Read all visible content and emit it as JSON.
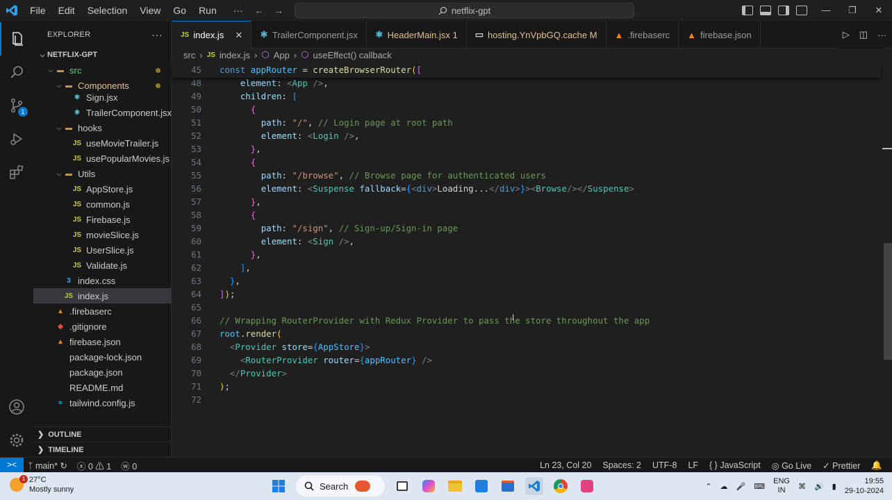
{
  "titlebar": {
    "menu": [
      "File",
      "Edit",
      "Selection",
      "View",
      "Go",
      "Run"
    ],
    "more": "···",
    "search": "netflix-gpt"
  },
  "activity": {
    "scm_badge": "1"
  },
  "sidebar": {
    "header": "EXPLORER",
    "more": "···",
    "rows": [
      {
        "label": "NETFLIX-GPT",
        "kind": "root",
        "indent": 0
      },
      {
        "label": "src",
        "kind": "folder",
        "indent": 1
      },
      {
        "label": "Components",
        "kind": "folder",
        "indent": 2
      },
      {
        "label": "Sign.jsx",
        "kind": "react",
        "indent": 3
      },
      {
        "label": "TrailerComponent.jsx",
        "kind": "react",
        "indent": 3
      },
      {
        "label": "hooks",
        "kind": "folder",
        "indent": 2
      },
      {
        "label": "useMovieTrailer.js",
        "kind": "js",
        "indent": 3
      },
      {
        "label": "usePopularMovies.js",
        "kind": "js",
        "indent": 3
      },
      {
        "label": "Utils",
        "kind": "folder",
        "indent": 2
      },
      {
        "label": "AppStore.js",
        "kind": "js",
        "indent": 3
      },
      {
        "label": "common.js",
        "kind": "js",
        "indent": 3
      },
      {
        "label": "Firebase.js",
        "kind": "js",
        "indent": 3
      },
      {
        "label": "movieSlice.js",
        "kind": "js",
        "indent": 3
      },
      {
        "label": "UserSlice.js",
        "kind": "js",
        "indent": 3
      },
      {
        "label": "Validate.js",
        "kind": "js",
        "indent": 3
      },
      {
        "label": "index.css",
        "kind": "css",
        "indent": 2
      },
      {
        "label": "index.js",
        "kind": "js",
        "indent": 2
      },
      {
        "label": ".firebaserc",
        "kind": "firebase",
        "indent": 1
      },
      {
        "label": ".gitignore",
        "kind": "git",
        "indent": 1
      },
      {
        "label": "firebase.json",
        "kind": "firebase",
        "indent": 1
      },
      {
        "label": "package-lock.json",
        "kind": "plain",
        "indent": 1
      },
      {
        "label": "package.json",
        "kind": "plain",
        "indent": 1
      },
      {
        "label": "README.md",
        "kind": "plain",
        "indent": 1
      },
      {
        "label": "tailwind.config.js",
        "kind": "tw",
        "indent": 1
      }
    ],
    "outline": "OUTLINE",
    "timeline": "TIMELINE"
  },
  "tabs": [
    {
      "label": "index.js",
      "icon": "JS"
    },
    {
      "label": "TrailerComponent.jsx",
      "icon": "react"
    },
    {
      "label": "HeaderMain.jsx 1",
      "icon": "react"
    },
    {
      "label": "hosting.YnVpbGQ.cache M",
      "icon": "file"
    },
    {
      "label": ".firebaserc",
      "icon": "firebase"
    },
    {
      "label": "firebase.json",
      "icon": "firebase"
    }
  ],
  "breadcrumb": [
    "src",
    "index.js",
    "App",
    "useEffect() callback"
  ],
  "code": [
    {
      "n": "45",
      "t": [
        [
          "kw",
          "const "
        ],
        [
          "var",
          "appRouter"
        ],
        [
          "punc",
          " = "
        ],
        [
          "fn",
          "createBrowserRouter"
        ],
        [
          "p1",
          "("
        ],
        [
          "p2",
          "["
        ]
      ]
    },
    {
      "n": "48",
      "t": [
        [
          "punc",
          "    "
        ],
        [
          "prop",
          "element"
        ],
        [
          "punc",
          ": "
        ],
        [
          "br",
          "<"
        ],
        [
          "tag",
          "App"
        ],
        [
          "br",
          " />"
        ],
        [
          "punc",
          ","
        ]
      ]
    },
    {
      "n": "49",
      "t": [
        [
          "punc",
          "    "
        ],
        [
          "prop",
          "children"
        ],
        [
          "punc",
          ": "
        ],
        [
          "p3",
          "["
        ]
      ]
    },
    {
      "n": "50",
      "t": [
        [
          "punc",
          "      "
        ],
        [
          "p2",
          "{"
        ]
      ]
    },
    {
      "n": "51",
      "t": [
        [
          "punc",
          "        "
        ],
        [
          "prop",
          "path"
        ],
        [
          "punc",
          ": "
        ],
        [
          "str",
          "\"/\""
        ],
        [
          "punc",
          ", "
        ],
        [
          "cm",
          "// Login page at root path"
        ]
      ]
    },
    {
      "n": "52",
      "t": [
        [
          "punc",
          "        "
        ],
        [
          "prop",
          "element"
        ],
        [
          "punc",
          ": "
        ],
        [
          "br",
          "<"
        ],
        [
          "tag",
          "Login"
        ],
        [
          "br",
          " />"
        ],
        [
          "punc",
          ","
        ]
      ]
    },
    {
      "n": "53",
      "t": [
        [
          "punc",
          "      "
        ],
        [
          "p2",
          "}"
        ],
        [
          "punc",
          ","
        ]
      ]
    },
    {
      "n": "54",
      "t": [
        [
          "punc",
          "      "
        ],
        [
          "p2",
          "{"
        ]
      ]
    },
    {
      "n": "55",
      "t": [
        [
          "punc",
          "        "
        ],
        [
          "prop",
          "path"
        ],
        [
          "punc",
          ": "
        ],
        [
          "str",
          "\"/browse\""
        ],
        [
          "punc",
          ", "
        ],
        [
          "cm",
          "// Browse page for authenticated users"
        ]
      ]
    },
    {
      "n": "56",
      "t": [
        [
          "punc",
          "        "
        ],
        [
          "prop",
          "element"
        ],
        [
          "punc",
          ": "
        ],
        [
          "br",
          "<"
        ],
        [
          "tag",
          "Suspense"
        ],
        [
          "punc",
          " "
        ],
        [
          "prop",
          "fallback"
        ],
        [
          "punc",
          "="
        ],
        [
          "p3",
          "{"
        ],
        [
          "br",
          "<"
        ],
        [
          "kw",
          "div"
        ],
        [
          "br",
          ">"
        ],
        [
          "punc",
          "Loading..."
        ],
        [
          "br",
          "</"
        ],
        [
          "kw",
          "div"
        ],
        [
          "br",
          ">"
        ],
        [
          "p3",
          "}"
        ],
        [
          "br",
          "><"
        ],
        [
          "tag",
          "Browse"
        ],
        [
          "br",
          "/></"
        ],
        [
          "tag",
          "Suspense"
        ],
        [
          "br",
          ">"
        ]
      ]
    },
    {
      "n": "57",
      "t": [
        [
          "punc",
          "      "
        ],
        [
          "p2",
          "}"
        ],
        [
          "punc",
          ","
        ]
      ]
    },
    {
      "n": "58",
      "t": [
        [
          "punc",
          "      "
        ],
        [
          "p2",
          "{"
        ]
      ]
    },
    {
      "n": "59",
      "t": [
        [
          "punc",
          "        "
        ],
        [
          "prop",
          "path"
        ],
        [
          "punc",
          ": "
        ],
        [
          "str",
          "\"/sign\""
        ],
        [
          "punc",
          ", "
        ],
        [
          "cm",
          "// Sign-up/Sign-in page"
        ]
      ]
    },
    {
      "n": "60",
      "t": [
        [
          "punc",
          "        "
        ],
        [
          "prop",
          "element"
        ],
        [
          "punc",
          ": "
        ],
        [
          "br",
          "<"
        ],
        [
          "tag",
          "Sign"
        ],
        [
          "br",
          " />"
        ],
        [
          "punc",
          ","
        ]
      ]
    },
    {
      "n": "61",
      "t": [
        [
          "punc",
          "      "
        ],
        [
          "p2",
          "}"
        ],
        [
          "punc",
          ","
        ]
      ]
    },
    {
      "n": "62",
      "t": [
        [
          "punc",
          "    "
        ],
        [
          "p3",
          "]"
        ],
        [
          "punc",
          ","
        ]
      ]
    },
    {
      "n": "63",
      "t": [
        [
          "punc",
          "  "
        ],
        [
          "p3",
          "}"
        ],
        [
          "punc",
          ","
        ]
      ]
    },
    {
      "n": "64",
      "t": [
        [
          "p2",
          "]"
        ],
        [
          "p1",
          ")"
        ],
        [
          "punc",
          ";"
        ]
      ]
    },
    {
      "n": "65",
      "t": []
    },
    {
      "n": "66",
      "t": [
        [
          "cm",
          "// Wrapping RouterProvider with Redux Provider to pass the store throughout the app"
        ]
      ]
    },
    {
      "n": "67",
      "t": [
        [
          "var",
          "root"
        ],
        [
          "punc",
          "."
        ],
        [
          "fn",
          "render"
        ],
        [
          "p1",
          "("
        ]
      ]
    },
    {
      "n": "68",
      "t": [
        [
          "punc",
          "  "
        ],
        [
          "br",
          "<"
        ],
        [
          "tag",
          "Provider"
        ],
        [
          "punc",
          " "
        ],
        [
          "prop",
          "store"
        ],
        [
          "punc",
          "="
        ],
        [
          "p3",
          "{"
        ],
        [
          "var",
          "AppStore"
        ],
        [
          "p3",
          "}"
        ],
        [
          "br",
          ">"
        ]
      ]
    },
    {
      "n": "69",
      "t": [
        [
          "punc",
          "    "
        ],
        [
          "br",
          "<"
        ],
        [
          "tag",
          "RouterProvider"
        ],
        [
          "punc",
          " "
        ],
        [
          "prop",
          "router"
        ],
        [
          "punc",
          "="
        ],
        [
          "p3",
          "{"
        ],
        [
          "var",
          "appRouter"
        ],
        [
          "p3",
          "}"
        ],
        [
          "br",
          " />"
        ]
      ]
    },
    {
      "n": "70",
      "t": [
        [
          "punc",
          "  "
        ],
        [
          "br",
          "</"
        ],
        [
          "tag",
          "Provider"
        ],
        [
          "br",
          ">"
        ]
      ]
    },
    {
      "n": "71",
      "t": [
        [
          "p1",
          ")"
        ],
        [
          "punc",
          ";"
        ]
      ]
    },
    {
      "n": "72",
      "t": []
    }
  ],
  "status": {
    "branch": "main*",
    "errors": "ⓧ 0 ⚠ 1",
    "ports": "ⓦ 0",
    "position": "Ln 23, Col 20",
    "spaces": "Spaces: 2",
    "encoding": "UTF-8",
    "eol": "LF",
    "language": "{ } JavaScript",
    "golive": "Go Live",
    "prettier": "✓ Prettier"
  },
  "taskbar": {
    "temp": "27°C",
    "weather": "Mostly sunny",
    "weather_badge": "1",
    "search": "Search",
    "lang": "ENG",
    "region": "IN",
    "time": "19:55",
    "date": "29-10-2024"
  },
  "colors": {
    "accent": "#0078d4",
    "editor_bg": "#1f1f1f",
    "sidebar_bg": "#181818"
  }
}
